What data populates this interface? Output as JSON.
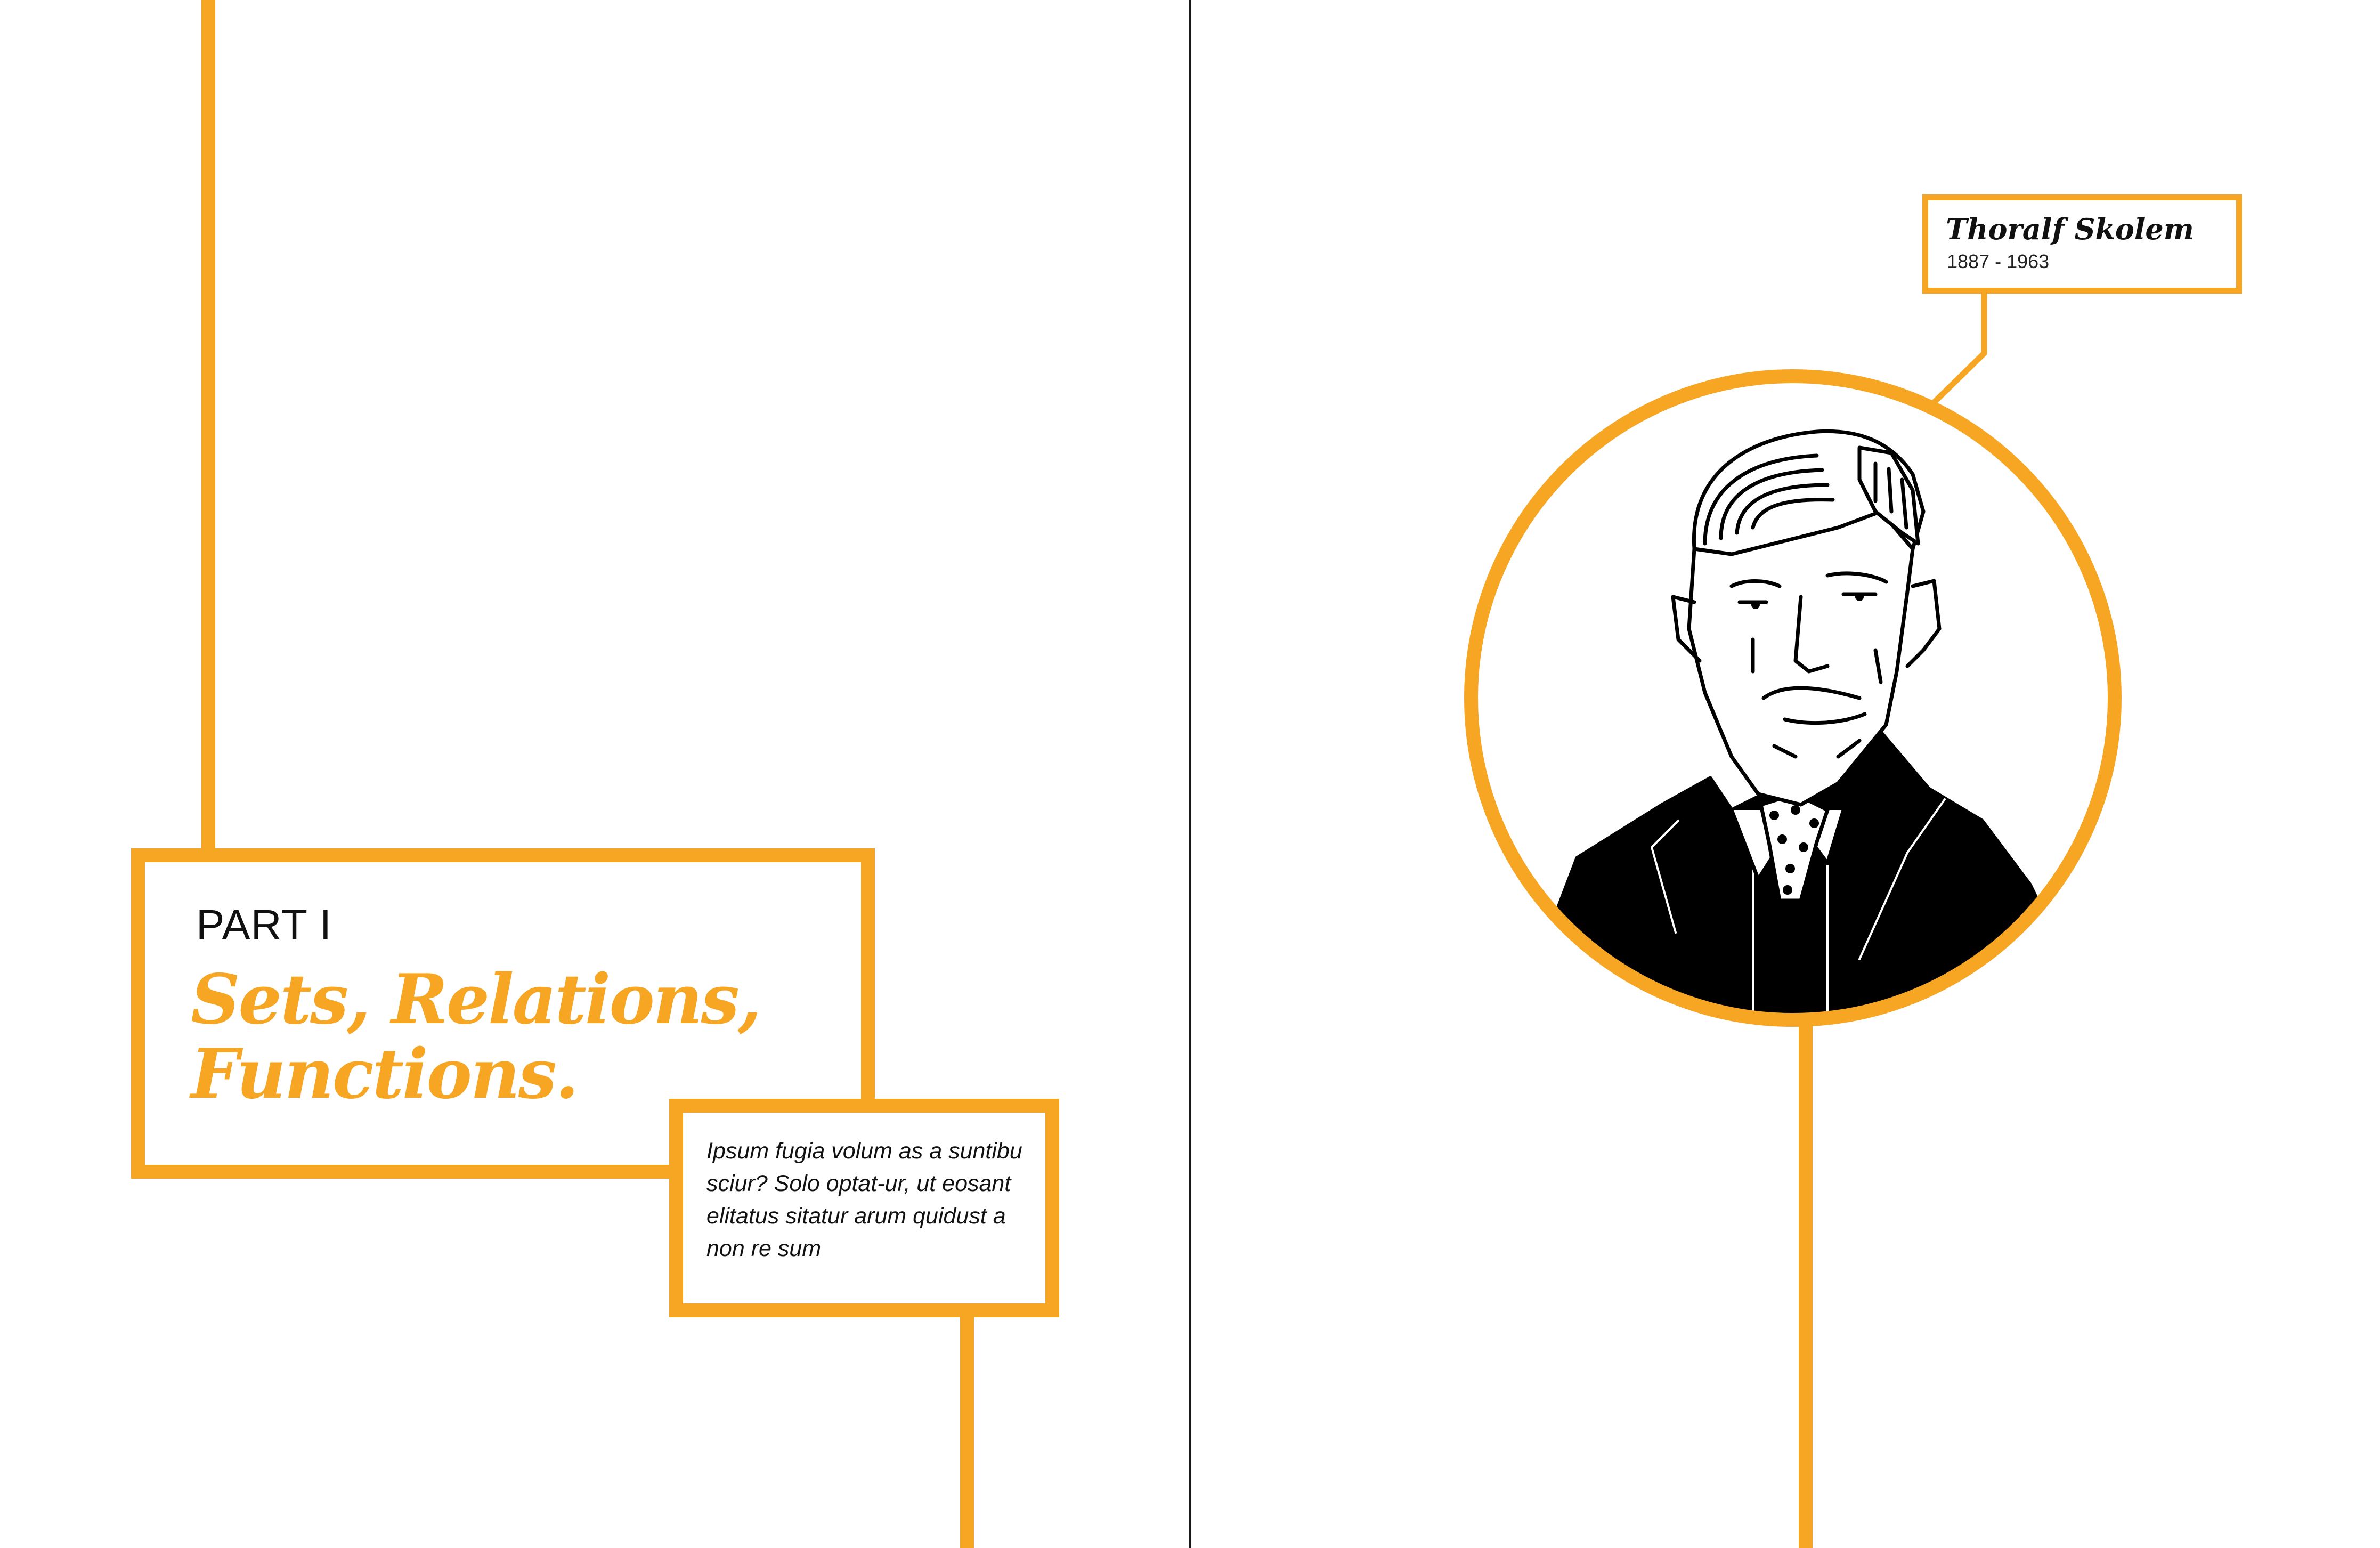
{
  "colors": {
    "accent": "#F6A623",
    "ink": "#111111",
    "background": "#ffffff"
  },
  "left_page": {
    "part_label": "PART I",
    "chapter_title_line1": "Sets, Relations,",
    "chapter_title_line2": "Functions.",
    "intro_text": "Ipsum fugia volum as a suntibu sciur? Solo optat-ur, ut eosant elitatus sitatur arum quidust a non re sum"
  },
  "right_page": {
    "person_name": "Thoralf Skolem",
    "person_years": "1887 - 1963",
    "portrait_icon": "portrait-illustration"
  }
}
